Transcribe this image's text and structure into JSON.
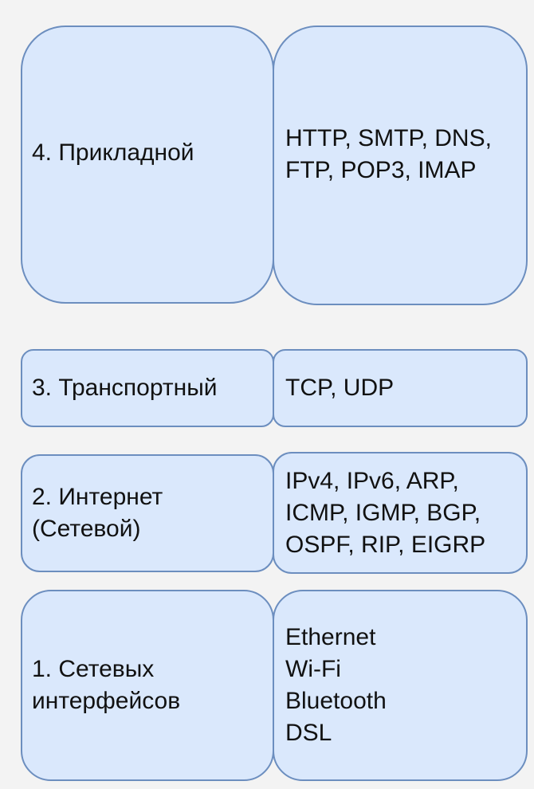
{
  "layers": [
    {
      "name": "4. Прикладной",
      "protocols": "HTTP, SMTP, DNS,\nFTP, POP3, IMAP"
    },
    {
      "name": "3. Транспортный",
      "protocols": "TCP, UDP"
    },
    {
      "name": "2. Интернет\n(Сетевой)",
      "protocols": "IPv4, IPv6, ARP,\nICMP, IGMP, BGP,\nOSPF, RIP, EIGRP"
    },
    {
      "name": "1. Сетевых\nинтерфейсов",
      "protocols": "Ethernet\nWi-Fi\nBluetooth\nDSL"
    }
  ],
  "colors": {
    "background": "#f3f3f3",
    "box_fill": "#dae8fc",
    "box_stroke": "#6c8ebf",
    "text": "#111111"
  }
}
